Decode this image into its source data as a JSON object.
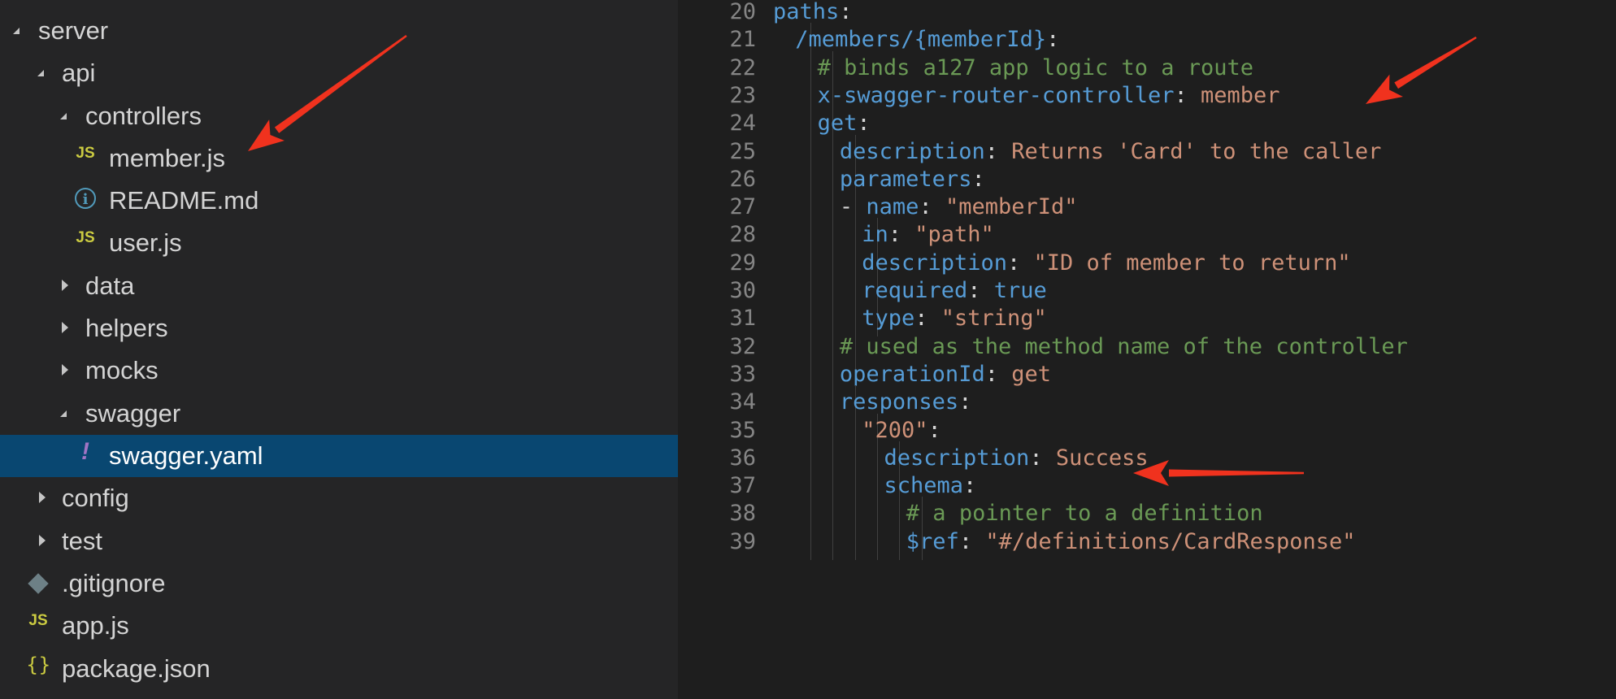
{
  "explorer": {
    "items": [
      {
        "label": "server",
        "icon": "none",
        "twisty": "expanded",
        "depth": 0
      },
      {
        "label": "api",
        "icon": "none",
        "twisty": "expanded",
        "depth": 1
      },
      {
        "label": "controllers",
        "icon": "none",
        "twisty": "expanded",
        "depth": 2
      },
      {
        "label": "member.js",
        "icon": "js-file-icon",
        "icon_text": "JS",
        "twisty": "none",
        "depth": 3
      },
      {
        "label": "README.md",
        "icon": "info-icon",
        "icon_text": "i",
        "twisty": "none",
        "depth": 3
      },
      {
        "label": "user.js",
        "icon": "js-file-icon",
        "icon_text": "JS",
        "twisty": "none",
        "depth": 3
      },
      {
        "label": "data",
        "icon": "none",
        "twisty": "collapsed",
        "depth": 2
      },
      {
        "label": "helpers",
        "icon": "none",
        "twisty": "collapsed",
        "depth": 2
      },
      {
        "label": "mocks",
        "icon": "none",
        "twisty": "collapsed",
        "depth": 2
      },
      {
        "label": "swagger",
        "icon": "none",
        "twisty": "expanded",
        "depth": 2
      },
      {
        "label": "swagger.yaml",
        "icon": "yaml-file-icon",
        "icon_text": "!",
        "twisty": "none",
        "depth": 3,
        "selected": true
      },
      {
        "label": "config",
        "icon": "none",
        "twisty": "collapsed",
        "depth": 1
      },
      {
        "label": "test",
        "icon": "none",
        "twisty": "collapsed",
        "depth": 1
      },
      {
        "label": ".gitignore",
        "icon": "git-file-icon",
        "icon_text": "",
        "twisty": "none",
        "depth": 1
      },
      {
        "label": "app.js",
        "icon": "js-file-icon",
        "icon_text": "JS",
        "twisty": "none",
        "depth": 1
      },
      {
        "label": "package.json",
        "icon": "json-file-icon",
        "icon_text": "{}",
        "twisty": "none",
        "depth": 1
      }
    ]
  },
  "editor": {
    "lines": [
      {
        "num": "20",
        "indent": 0,
        "tokens": [
          {
            "t": "k",
            "v": "paths"
          },
          {
            "t": "p",
            "v": ":"
          }
        ]
      },
      {
        "num": "21",
        "indent": 1,
        "tokens": [
          {
            "t": "k",
            "v": "/members/{memberId}"
          },
          {
            "t": "p",
            "v": ":"
          }
        ]
      },
      {
        "num": "22",
        "indent": 2,
        "tokens": [
          {
            "t": "c",
            "v": "# binds a127 app logic to a route"
          }
        ]
      },
      {
        "num": "23",
        "indent": 2,
        "tokens": [
          {
            "t": "k",
            "v": "x-swagger-router-controller"
          },
          {
            "t": "p",
            "v": ": "
          },
          {
            "t": "s",
            "v": "member"
          }
        ]
      },
      {
        "num": "24",
        "indent": 2,
        "tokens": [
          {
            "t": "k",
            "v": "get"
          },
          {
            "t": "p",
            "v": ":"
          }
        ]
      },
      {
        "num": "25",
        "indent": 3,
        "tokens": [
          {
            "t": "k",
            "v": "description"
          },
          {
            "t": "p",
            "v": ": "
          },
          {
            "t": "s",
            "v": "Returns 'Card' to the caller"
          }
        ]
      },
      {
        "num": "26",
        "indent": 3,
        "tokens": [
          {
            "t": "k",
            "v": "parameters"
          },
          {
            "t": "p",
            "v": ":"
          }
        ]
      },
      {
        "num": "27",
        "indent": 3,
        "tokens": [
          {
            "t": "p",
            "v": "- "
          },
          {
            "t": "k",
            "v": "name"
          },
          {
            "t": "p",
            "v": ": "
          },
          {
            "t": "s",
            "v": "\"memberId\""
          }
        ]
      },
      {
        "num": "28",
        "indent": 4,
        "tokens": [
          {
            "t": "k",
            "v": "in"
          },
          {
            "t": "p",
            "v": ": "
          },
          {
            "t": "s",
            "v": "\"path\""
          }
        ]
      },
      {
        "num": "29",
        "indent": 4,
        "tokens": [
          {
            "t": "k",
            "v": "description"
          },
          {
            "t": "p",
            "v": ": "
          },
          {
            "t": "s",
            "v": "\"ID of member to return\""
          }
        ]
      },
      {
        "num": "30",
        "indent": 4,
        "tokens": [
          {
            "t": "k",
            "v": "required"
          },
          {
            "t": "p",
            "v": ": "
          },
          {
            "t": "b",
            "v": "true"
          }
        ]
      },
      {
        "num": "31",
        "indent": 4,
        "tokens": [
          {
            "t": "k",
            "v": "type"
          },
          {
            "t": "p",
            "v": ": "
          },
          {
            "t": "s",
            "v": "\"string\""
          }
        ]
      },
      {
        "num": "32",
        "indent": 3,
        "tokens": [
          {
            "t": "c",
            "v": "# used as the method name of the controller"
          }
        ]
      },
      {
        "num": "33",
        "indent": 3,
        "tokens": [
          {
            "t": "k",
            "v": "operationId"
          },
          {
            "t": "p",
            "v": ": "
          },
          {
            "t": "s",
            "v": "get"
          }
        ]
      },
      {
        "num": "34",
        "indent": 3,
        "tokens": [
          {
            "t": "k",
            "v": "responses"
          },
          {
            "t": "p",
            "v": ":"
          }
        ]
      },
      {
        "num": "35",
        "indent": 4,
        "tokens": [
          {
            "t": "s",
            "v": "\"200\""
          },
          {
            "t": "p",
            "v": ":"
          }
        ]
      },
      {
        "num": "36",
        "indent": 5,
        "tokens": [
          {
            "t": "k",
            "v": "description"
          },
          {
            "t": "p",
            "v": ": "
          },
          {
            "t": "s",
            "v": "Success"
          }
        ]
      },
      {
        "num": "37",
        "indent": 5,
        "tokens": [
          {
            "t": "k",
            "v": "schema"
          },
          {
            "t": "p",
            "v": ":"
          }
        ]
      },
      {
        "num": "38",
        "indent": 6,
        "tokens": [
          {
            "t": "c",
            "v": "# a pointer to a definition"
          }
        ]
      },
      {
        "num": "39",
        "indent": 6,
        "tokens": [
          {
            "t": "k",
            "v": "$ref"
          },
          {
            "t": "p",
            "v": ": "
          },
          {
            "t": "s",
            "v": "\"#/definitions/CardResponse\""
          }
        ]
      }
    ]
  },
  "annotations": {
    "arrow_color": "#f0321e"
  },
  "colors": {
    "sidebar_bg": "#252526",
    "editor_bg": "#1e1e1e",
    "selection_bg": "#094771",
    "key": "#569cd6",
    "string": "#ce9178",
    "comment": "#6a9955"
  }
}
